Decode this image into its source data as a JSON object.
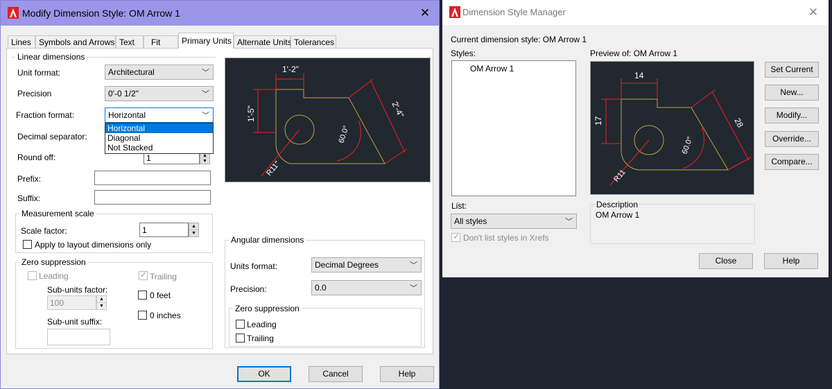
{
  "modify": {
    "title": "Modify Dimension Style: OM Arrow 1",
    "tabs": [
      "Lines",
      "Symbols and Arrows",
      "Text",
      "Fit",
      "Primary Units",
      "Alternate Units",
      "Tolerances"
    ],
    "linear": {
      "group_label": "Linear dimensions",
      "unit_format_label": "Unit format:",
      "unit_format_value": "Architectural",
      "precision_label": "Precision",
      "precision_value": "0'-0 1/2\"",
      "fraction_label": "Fraction format:",
      "fraction_value": "Horizontal",
      "fraction_options": [
        "Horizontal",
        "Diagonal",
        "Not Stacked"
      ],
      "decimal_label": "Decimal separator:",
      "roundoff_label": "Round off:",
      "roundoff_value": "1",
      "prefix_label": "Prefix:",
      "suffix_label": "Suffix:"
    },
    "measurement": {
      "group_label": "Measurement scale",
      "scale_label": "Scale factor:",
      "scale_value": "1",
      "apply_label": "Apply to layout dimensions only"
    },
    "zero": {
      "group_label": "Zero suppression",
      "leading": "Leading",
      "trailing": "Trailing",
      "subunits_factor_label": "Sub-units factor:",
      "subunits_factor_value": "100",
      "feet": "0 feet",
      "inches": "0 inches",
      "subunit_suffix_label": "Sub-unit suffix:"
    },
    "preview_dims": {
      "top": "1'-2\"",
      "left": "1'-5\"",
      "diag": "2'-4\"",
      "angle": "60.0°",
      "radius": "R11\""
    },
    "angular": {
      "group_label": "Angular dimensions",
      "units_label": "Units format:",
      "units_value": "Decimal Degrees",
      "precision_label": "Precision:",
      "precision_value": "0.0",
      "zero_label": "Zero suppression",
      "leading": "Leading",
      "trailing": "Trailing"
    },
    "buttons": {
      "ok": "OK",
      "cancel": "Cancel",
      "help": "Help"
    }
  },
  "manager": {
    "title": "Dimension Style Manager",
    "current_label": "Current dimension style: OM Arrow 1",
    "styles_label": "Styles:",
    "style_item": "OM Arrow 1",
    "preview_label": "Preview of: OM Arrow 1",
    "preview_dims": {
      "top": "14",
      "left": "17",
      "diag": "28",
      "angle": "60.0°",
      "radius": "R11"
    },
    "list_label": "List:",
    "list_value": "All styles",
    "xrefs_label": "Don't list styles in Xrefs",
    "description_label": "Description",
    "description_value": "OM Arrow 1",
    "buttons": {
      "set_current": "Set Current",
      "new": "New...",
      "modify": "Modify...",
      "override": "Override...",
      "compare": "Compare...",
      "close": "Close",
      "help": "Help"
    }
  },
  "colors": {
    "modify_titlebar": "#9b96e8",
    "accent_blue": "#0078d7",
    "preview_bg": "#212830",
    "geometry": "#c2a23a",
    "dim_red": "#ff1a1a"
  }
}
